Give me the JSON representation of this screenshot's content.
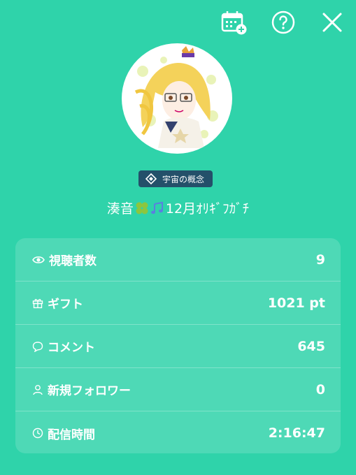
{
  "header": {
    "icons": [
      "calendar-add-icon",
      "help-icon",
      "close-icon"
    ]
  },
  "community": {
    "label": "宇宙の概念"
  },
  "user": {
    "name_prefix": "湊音",
    "name_suffix": "12月ｵﾘｷﾞﾌｶﾞﾁ"
  },
  "stats": [
    {
      "icon": "eye-icon",
      "label": "視聴者数",
      "value": "9"
    },
    {
      "icon": "gift-icon",
      "label": "ギフト",
      "value": "1021 pt"
    },
    {
      "icon": "comment-icon",
      "label": "コメント",
      "value": "645"
    },
    {
      "icon": "person-icon",
      "label": "新規フォロワー",
      "value": "0"
    },
    {
      "icon": "clock-icon",
      "label": "配信時間",
      "value": "2:16:47"
    }
  ],
  "colors": {
    "background": "#2fd3aa",
    "badge": "#24506a",
    "text": "#ffffff"
  }
}
